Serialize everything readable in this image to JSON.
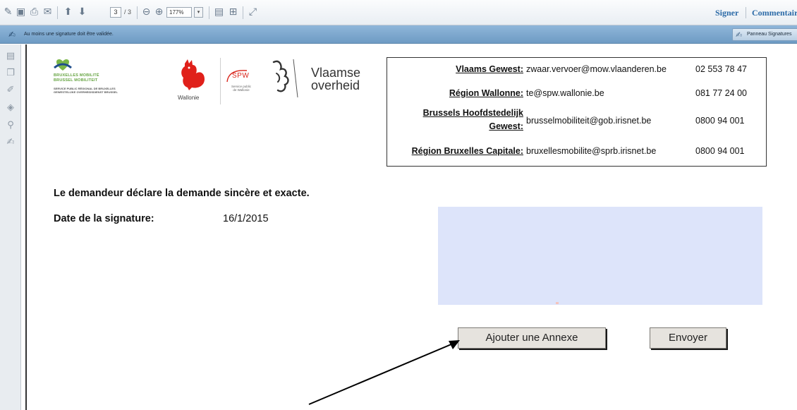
{
  "toolbar": {
    "page_current": "3",
    "page_total": "/ 3",
    "zoom": "177%",
    "sign_label": "Signer",
    "comment_label": "Commentaire",
    "icons": [
      "edit-icon",
      "save-icon",
      "print-icon",
      "email-icon",
      "page-up-icon",
      "page-down-icon",
      "zoom-out-icon",
      "zoom-in-icon",
      "fit-page-icon",
      "fit-width-icon",
      "expand-icon"
    ]
  },
  "infobar": {
    "message": "Au moins une signature doit être validée.",
    "panel_button": "Panneau Signatures"
  },
  "logos": {
    "bm_line1": "BRUXELLES MOBILITÉ",
    "bm_line2": "BRUSSEL MOBILITEIT",
    "bm_sub1": "SERVICE PUBLIC RÉGIONAL DE BRUXELLES",
    "bm_sub2": "GEWESTELIJKE OVERHEIDSDIENST BRUSSEL",
    "wallonie": "Wallonie",
    "spw": "SPW",
    "spw_sub1": "Service public",
    "spw_sub2": "de Wallonie",
    "vlaamse1": "Vlaamse",
    "vlaamse2": "overheid"
  },
  "contacts": [
    {
      "name": "Vlaams Gewest:",
      "email": "zwaar.vervoer@mow.vlaanderen.be",
      "phone": "02 553 78 47"
    },
    {
      "name": "Région Wallonne:",
      "email": "te@spw.wallonie.be",
      "phone": "081 77 24 00"
    },
    {
      "name_line1": "Brussels Hoofdstedelijk",
      "name_line2": "Gewest:",
      "email": "brusselmobiliteit@gob.irisnet.be",
      "phone": "0800 94 001"
    },
    {
      "name": "Région Bruxelles Capitale:",
      "email": "bruxellesmobilite@sprb.irisnet.be",
      "phone": "0800 94 001"
    }
  ],
  "form": {
    "declaration": "Le demandeur déclare la demande sincère et exacte.",
    "date_label": "Date de la signature:",
    "date_value": "16/1/2015",
    "annex_button": "Ajouter une Annexe",
    "send_button": "Envoyer"
  },
  "colors": {
    "signature_field": "#dde4fa",
    "infobar": "#7fa9cf",
    "link": "#2b6aa7"
  }
}
